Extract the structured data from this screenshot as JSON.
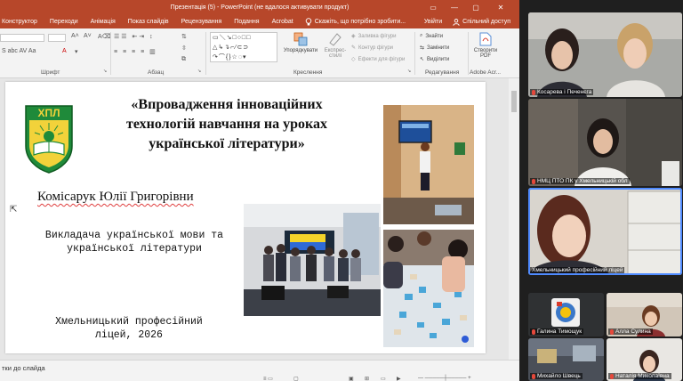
{
  "window": {
    "title": "Презентація (5) - PowerPoint (не вдалося активувати продукт)"
  },
  "ribbon_tabs": [
    "Конструктор",
    "Переходи",
    "Анімація",
    "Показ слайдів",
    "Рецензування",
    "Подання",
    "Acrobat"
  ],
  "tell_me": "Скажіть, що потрібно зробити...",
  "account": {
    "signin": "Увійти",
    "share": "Спільний доступ"
  },
  "ribbon": {
    "groups": {
      "font": "Шрифт",
      "paragraph": "Абзац",
      "drawing": "Креслення",
      "editing": "Редагування",
      "adobe": "Adobe Acr..."
    },
    "arrange": "Упорядкувати",
    "quick_styles": "Експрес-стилі",
    "shape_fill": "Заливка фігури",
    "shape_outline": "Контур фігури",
    "shape_effects": "Ефекти для фігури",
    "find": "Знайти",
    "replace": "Замінити",
    "select": "Виділити",
    "create_pdf": "Створити PDF"
  },
  "slide": {
    "logo_text": "ХПЛ",
    "title": "«Впровадження інноваційних технологій навчання на уроках української літератури»",
    "author": "Комісарук Юлії Григорівни",
    "role": "Викладача української мови та української літератури",
    "college": "Хмельницький професійний ліцей, 2026"
  },
  "status": {
    "notes": "тки до слайда"
  },
  "participants": [
    {
      "name": "Косарева і Печенєга",
      "muted": true
    },
    {
      "name": "НМЦ ПТО ПК у Хмельницькій обл",
      "muted": true
    },
    {
      "name": "Хмельницький професійний ліцей",
      "muted": false
    },
    {
      "name": "Галина Тимощук",
      "muted": true
    },
    {
      "name": "Алла Сулина",
      "muted": true
    },
    {
      "name": "Михайло Швець",
      "muted": true
    },
    {
      "name": "Наталія Миколаївна",
      "muted": true
    }
  ],
  "colors": {
    "ppt_accent": "#b7472a",
    "active_speaker": "#4f8bff",
    "muted_mic": "#e5483b"
  }
}
